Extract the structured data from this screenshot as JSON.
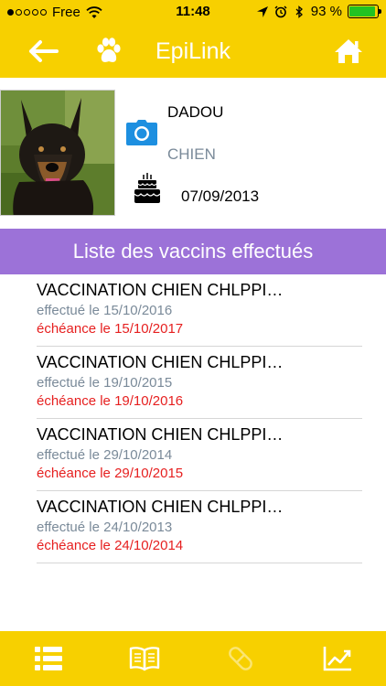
{
  "status_bar": {
    "carrier": "Free",
    "time": "11:48",
    "battery": "93 %",
    "battery_level": 0.93,
    "icons": [
      "signal-dots",
      "wifi-icon",
      "location-icon",
      "alarm-icon",
      "bluetooth-icon",
      "battery-icon"
    ]
  },
  "navbar": {
    "title": "EpiLink",
    "icons": [
      "back-arrow-icon",
      "paw-icon",
      "home-icon"
    ]
  },
  "profile": {
    "name": "DADOU",
    "species": "CHIEN",
    "birth_date": "07/09/2013",
    "icons": [
      "camera-icon",
      "birthday-cake-icon"
    ]
  },
  "banner": {
    "title": "Liste des vaccins effectués",
    "color": "#9c72d8"
  },
  "vaccines": [
    {
      "title": "VACCINATION CHIEN CHLPPI…",
      "done": "effectué le 15/10/2016",
      "due": "échéance le 15/10/2017"
    },
    {
      "title": "VACCINATION CHIEN CHLPPI…",
      "done": "effectué le 19/10/2015",
      "due": "échéance le 19/10/2016"
    },
    {
      "title": "VACCINATION CHIEN CHLPPI…",
      "done": "effectué le 29/10/2014",
      "due": "échéance le 29/10/2015"
    },
    {
      "title": "VACCINATION CHIEN CHLPPI…",
      "done": "effectué le 24/10/2013",
      "due": "échéance le 24/10/2014"
    }
  ],
  "tabbar": {
    "icons": [
      "list-icon",
      "book-icon",
      "pill-icon",
      "chart-icon"
    ]
  },
  "colors": {
    "brand_yellow": "#f7d000",
    "banner_purple": "#9c72d8",
    "due_red": "#e61f1f",
    "subtle_gray": "#7a8a99",
    "camera_blue": "#1d8fe0"
  }
}
